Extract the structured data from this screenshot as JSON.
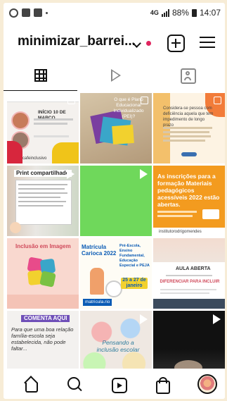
{
  "status_bar": {
    "signal": "4G",
    "battery": "88%",
    "time": "14:07"
  },
  "header": {
    "username": "minimizar_barrei...",
    "icons": [
      "chevron-down-icon",
      "notification-dot",
      "plus-square-icon",
      "hamburger-menu-icon"
    ]
  },
  "tabs": [
    {
      "name": "grid",
      "icon": "grid-icon",
      "active": true
    },
    {
      "name": "reels",
      "icon": "reels-icon",
      "active": false
    },
    {
      "name": "tagged",
      "icon": "tagged-icon",
      "active": false
    }
  ],
  "posts": [
    {
      "id": "p1",
      "text": "INÍCIO 10 DE MARÇO",
      "sub": "cafeinclusivo",
      "overlay": "multi"
    },
    {
      "id": "p2",
      "text": "O que é Plano Educacional Individualizado (PEI)?",
      "overlay": "multi"
    },
    {
      "id": "p3",
      "text": "Considera-se pessoa com deficiência aquela que tem impedimento de longo prazo",
      "overlay": "multi"
    },
    {
      "id": "p4",
      "text": "Print compartilhado",
      "overlay": "video"
    },
    {
      "id": "p5",
      "text": "",
      "overlay": "video"
    },
    {
      "id": "p6",
      "text": "As inscrições para a formação Materiais pedagógicos acessíveis 2022 estão abertas.",
      "sub": "institutorodrigomendes",
      "overlay": "none"
    },
    {
      "id": "p7",
      "text": "Inclusão em Imagem",
      "overlay": "none"
    },
    {
      "id": "p8",
      "text": "Matrícula Carioca 2022",
      "sub": "matricula.rio",
      "badge": "25 a 27 de janeiro",
      "side": "Pré-Escola, Ensino Fundamental, Educação Especial e PEJA",
      "overlay": "none"
    },
    {
      "id": "p9",
      "text": "AULA ABERTA",
      "sub": "DIFERENCIAR PARA INCLUIR",
      "overlay": "none"
    },
    {
      "id": "p10",
      "text": "COMENTA AQUI",
      "sub": "Para que uma boa relação família-escola seja estabelecida, não pode faltar...",
      "overlay": "none"
    },
    {
      "id": "p11",
      "text": "Pensando a inclusão escolar",
      "overlay": "video"
    },
    {
      "id": "p12",
      "text": "",
      "overlay": "video"
    }
  ],
  "bottom_nav": [
    {
      "name": "home",
      "icon": "home-icon"
    },
    {
      "name": "search",
      "icon": "search-icon"
    },
    {
      "name": "reels",
      "icon": "reels-icon"
    },
    {
      "name": "shop",
      "icon": "shop-icon"
    },
    {
      "name": "profile",
      "icon": "avatar"
    }
  ],
  "colors": {
    "accent_red": "#e0245e",
    "tile_green": "#6fd85b",
    "tile_orange": "#f39b1f"
  }
}
